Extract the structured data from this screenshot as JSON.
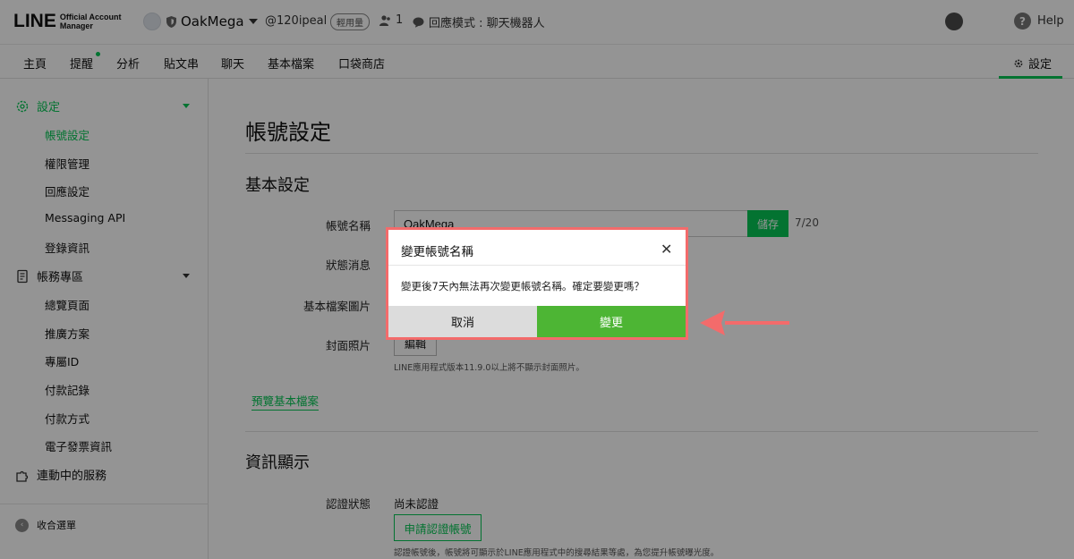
{
  "header": {
    "logo_line": "LINE",
    "logo_sub_1": "Official Account",
    "logo_sub_2": "Manager",
    "account_name": "OakMega",
    "account_id": "@120ipeal",
    "plan_badge": "輕用量",
    "member_count": "1",
    "response_mode": "回應模式 : 聊天機器人",
    "help_label": "Help"
  },
  "nav": {
    "items": [
      "主頁",
      "提醒",
      "分析",
      "貼文串",
      "聊天",
      "基本檔案",
      "口袋商店"
    ],
    "settings_label": "設定"
  },
  "sidebar": {
    "group_settings": "設定",
    "settings_items": [
      "帳號設定",
      "權限管理",
      "回應設定",
      "Messaging API",
      "登錄資訊"
    ],
    "group_account": "帳務專區",
    "account_items": [
      "總覽頁面",
      "推廣方案",
      "專屬ID",
      "付款記錄",
      "付款方式",
      "電子發票資訊"
    ],
    "group_services": "連動中的服務",
    "collapse_label": "收合選單"
  },
  "main": {
    "page_title": "帳號設定",
    "section_basic": "基本設定",
    "label_account_name": "帳號名稱",
    "account_name_value": "OakMega",
    "save_label": "儲存",
    "counter": "7/20",
    "label_status_message": "狀態消息",
    "label_profile_image": "基本檔案圖片",
    "label_cover_image": "封面照片",
    "edit_label": "編輯",
    "cover_note": "LINE應用程式版本11.9.0以上將不顯示封面照片。",
    "preview_link": "預覽基本檔案",
    "section_info": "資訊顯示",
    "label_cert_status": "認證狀態",
    "cert_status_value": "尚未認證",
    "apply_cert_label": "申請認證帳號",
    "cert_note": "認證帳號後，帳號將可顯示於LINE應用程式中的搜尋結果等處，為您提升帳號曝光度。"
  },
  "dialog": {
    "title": "變更帳號名稱",
    "message": "變更後7天內無法再次變更帳號名稱。確定要變更嗎？",
    "cancel_label": "取消",
    "confirm_label": "變更"
  },
  "colors": {
    "brand_green": "#06c755",
    "confirm_green": "#4db534",
    "highlight_red": "#f36b6b"
  }
}
